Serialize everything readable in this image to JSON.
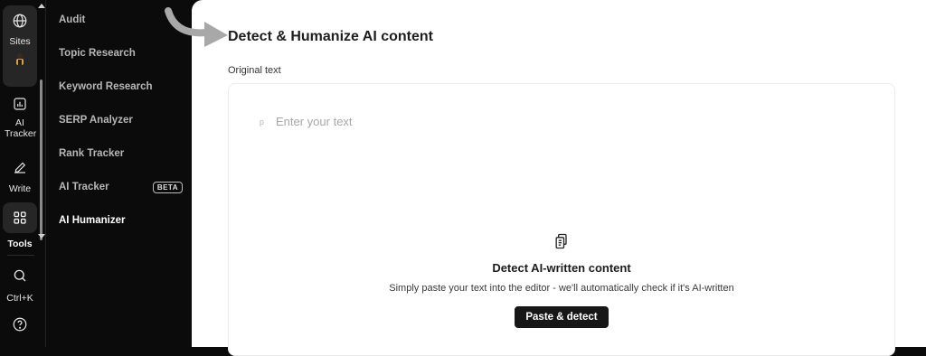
{
  "rail": {
    "sites_label": "Sites",
    "ai_tracker_label": "AI Tracker",
    "write_label": "Write",
    "tools_label": "Tools",
    "search_shortcut": "Ctrl+K"
  },
  "menu": {
    "items": [
      {
        "label": "Audit"
      },
      {
        "label": "Topic Research"
      },
      {
        "label": "Keyword Research"
      },
      {
        "label": "SERP Analyzer"
      },
      {
        "label": "Rank Tracker"
      },
      {
        "label": "AI Tracker",
        "badge": "BETA"
      },
      {
        "label": "AI Humanizer",
        "active": true
      }
    ]
  },
  "main": {
    "title": "Detect & Humanize AI content",
    "original_text_label": "Original text",
    "editor": {
      "block_tag": "p",
      "placeholder": "Enter your text"
    },
    "empty_state": {
      "icon": "clipboard-copy-icon",
      "title": "Detect AI-written content",
      "subtitle": "Simply paste your text into the editor - we'll automatically check if it's AI-written",
      "button_label": "Paste & detect"
    }
  },
  "colors": {
    "sidebar_bg": "#0b0b0b",
    "main_bg": "#ffffff",
    "button_bg": "#171717",
    "pointer_arrow": "#a8a8a8"
  }
}
